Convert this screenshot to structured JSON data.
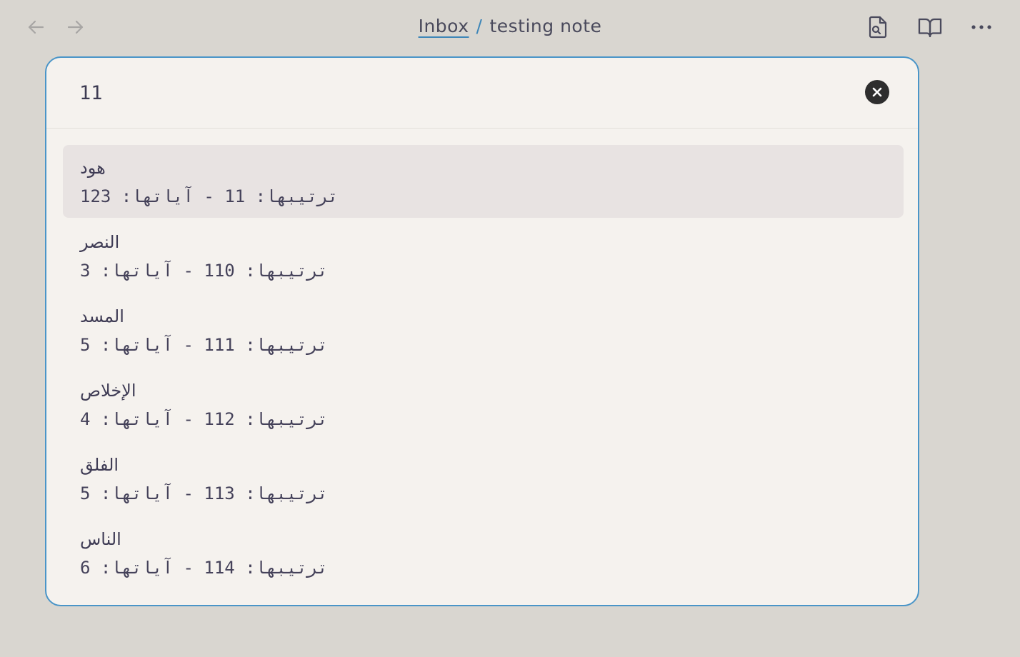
{
  "titlebar": {
    "breadcrumb_folder": "Inbox",
    "breadcrumb_separator": "/",
    "breadcrumb_note": "testing note"
  },
  "modal": {
    "search_value": "11",
    "results": [
      {
        "title": "هود",
        "subtitle": "ترتيبها: 11 - آياتها: 123",
        "selected": true
      },
      {
        "title": "النصر",
        "subtitle": "ترتيبها: 110 - آياتها: 3",
        "selected": false
      },
      {
        "title": "المسد",
        "subtitle": "ترتيبها: 111 - آياتها: 5",
        "selected": false
      },
      {
        "title": "الإخلاص",
        "subtitle": "ترتيبها: 112 - آياتها: 4",
        "selected": false
      },
      {
        "title": "الفلق",
        "subtitle": "ترتيبها: 113 - آياتها: 5",
        "selected": false
      },
      {
        "title": "الناس",
        "subtitle": "ترتيبها: 114 - آياتها: 6",
        "selected": false
      }
    ]
  },
  "colors": {
    "accent": "#4a95c8",
    "background": "#d9d6d0",
    "modal_background": "#f5f2ee",
    "selected_row": "#e8e3e2",
    "text": "#3f3c55"
  },
  "icons": {
    "back": "arrow-left-icon",
    "forward": "arrow-right-icon",
    "search_file": "file-search-icon",
    "reading_view": "open-book-icon",
    "more": "more-horizontal-icon",
    "clear": "close-circle-icon"
  }
}
